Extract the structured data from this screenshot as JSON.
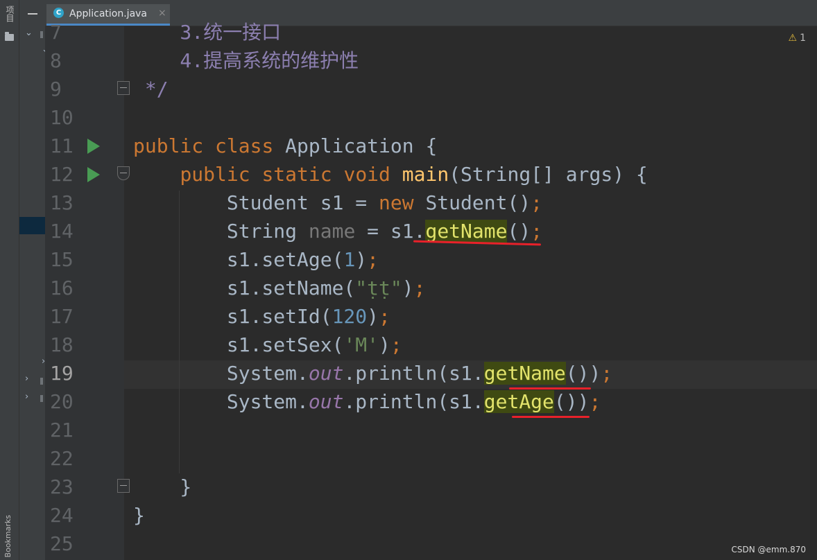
{
  "sidebar": {
    "project_label": "项目",
    "bookmarks_label": "Bookmarks"
  },
  "tab": {
    "title": "Application.java",
    "icon_letter": "C",
    "close": "×"
  },
  "inspection": {
    "warning_icon": "⚠",
    "warning_count": "1"
  },
  "watermark": "CSDN @emm.870",
  "lines": [
    {
      "n": "7",
      "text": "    3.统一接口"
    },
    {
      "n": "8",
      "text": "    4.提高系统的维护性"
    },
    {
      "n": "9",
      "text": " */"
    },
    {
      "n": "10",
      "text": ""
    },
    {
      "n": "11",
      "text": "public class Application {"
    },
    {
      "n": "12",
      "text": "    public static void main(String[] args) {"
    },
    {
      "n": "13",
      "text": "        Student s1 = new Student();"
    },
    {
      "n": "14",
      "text": "        String name = s1.getName();"
    },
    {
      "n": "15",
      "text": "        s1.setAge(1);"
    },
    {
      "n": "16",
      "text": "        s1.setName(\"ṭṭ\");"
    },
    {
      "n": "17",
      "text": "        s1.setId(120);"
    },
    {
      "n": "18",
      "text": "        s1.setSex('M');"
    },
    {
      "n": "19",
      "text": "        System.out.println(s1.getName());"
    },
    {
      "n": "20",
      "text": "        System.out.println(s1.getAge());"
    },
    {
      "n": "21",
      "text": ""
    },
    {
      "n": "22",
      "text": ""
    },
    {
      "n": "23",
      "text": "    }"
    },
    {
      "n": "24",
      "text": "}"
    },
    {
      "n": "25",
      "text": ""
    }
  ],
  "tokens": {
    "l7": "    3.统一接口",
    "l8": "    4.提高系统的维护性",
    "l9": " */",
    "kw_public": "public",
    "kw_class": "class",
    "cls_name": " Application {",
    "kw_static": "static",
    "kw_void": "void",
    "fn_main": "main",
    "main_args": "(String[] args) {",
    "student": "Student s1 = ",
    "kw_new": "new",
    "student_ctor": " Student()",
    "semi": ";",
    "str_decl": "String ",
    "var_name": "name",
    "assign_s1": " = s1.",
    "get_name": "getName",
    "call_close": "()",
    "set_age_open": "s1.setAge(",
    "num_1": "1",
    "paren_close": ")",
    "set_name_open": "s1.setName(",
    "str_tt": "\"ṭṭ\"",
    "set_id_open": "s1.setId(",
    "num_120": "120",
    "set_sex_open": "s1.setSex(",
    "char_m": "'M'",
    "system": "System.",
    "field_out": "out",
    "println_open": ".println(s1.",
    "call_close2": "())",
    "get_age": "getAge",
    "brace_close_inner": "    }",
    "brace_close_outer": "}"
  }
}
